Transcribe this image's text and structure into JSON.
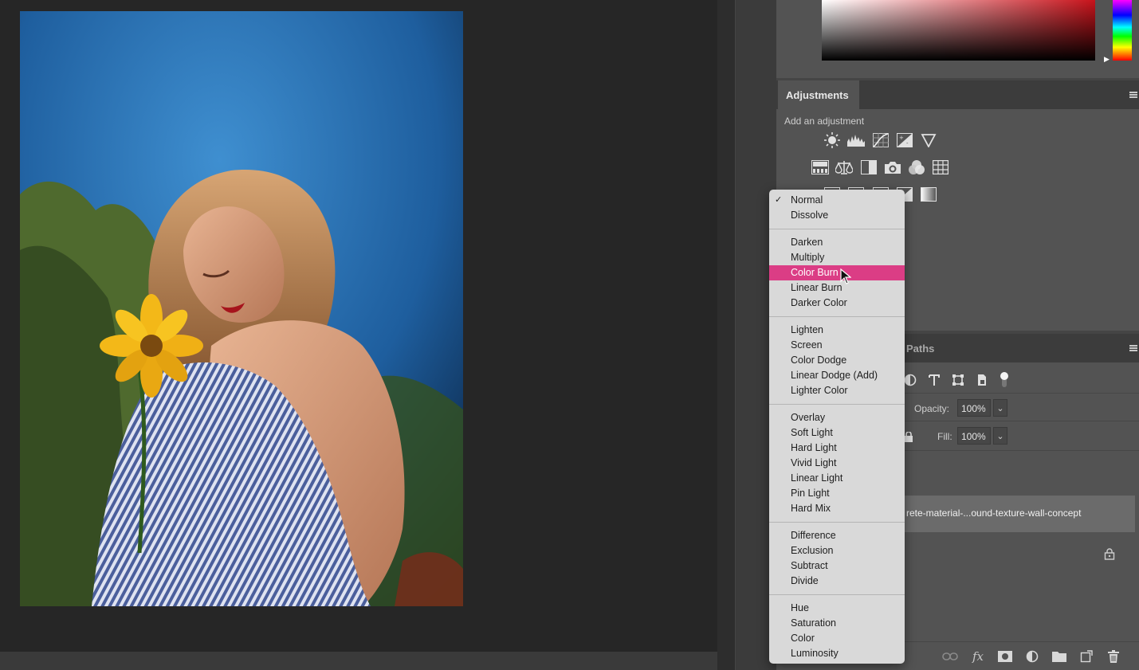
{
  "adjustments_panel": {
    "tab_label": "Adjustments",
    "add_label": "Add an adjustment",
    "icons_row1": [
      "brightness-contrast-icon",
      "levels-icon",
      "curves-icon",
      "exposure-icon",
      "vibrance-icon"
    ],
    "icons_row2": [
      "hue-saturation-icon",
      "color-balance-icon",
      "black-white-icon",
      "photo-filter-icon",
      "channel-mixer-icon",
      "color-lookup-icon"
    ],
    "icons_row3": [
      "invert-icon",
      "posterize-icon",
      "threshold-icon",
      "gradient-map-icon",
      "selective-color-icon"
    ]
  },
  "layers_panel": {
    "paths_tab_label": "Paths",
    "filter_icons": [
      "adjustment-filter-icon",
      "type-filter-icon",
      "shape-filter-icon",
      "smart-object-filter-icon",
      "filter-toggle-icon"
    ],
    "opacity_label": "Opacity:",
    "opacity_value": "100%",
    "fill_label": "Fill:",
    "fill_value": "100%",
    "layer_name": "rete-material-...ound-texture-wall-concept",
    "footer_icons": [
      "link-layers-icon",
      "layer-style-icon",
      "layer-mask-icon",
      "adjustment-layer-icon",
      "group-folder-icon",
      "new-layer-icon",
      "delete-layer-icon"
    ],
    "footer_glyphs": {
      "fx": "fx"
    }
  },
  "blend_menu": {
    "checked_item": "Normal",
    "highlighted_item": "Color Burn",
    "highlight_color": "#db3d85",
    "groups": [
      [
        "Normal",
        "Dissolve"
      ],
      [
        "Darken",
        "Multiply",
        "Color Burn",
        "Linear Burn",
        "Darker Color"
      ],
      [
        "Lighten",
        "Screen",
        "Color Dodge",
        "Linear Dodge (Add)",
        "Lighter Color"
      ],
      [
        "Overlay",
        "Soft Light",
        "Hard Light",
        "Vivid Light",
        "Linear Light",
        "Pin Light",
        "Hard Mix"
      ],
      [
        "Difference",
        "Exclusion",
        "Subtract",
        "Divide"
      ],
      [
        "Hue",
        "Saturation",
        "Color",
        "Luminosity"
      ]
    ]
  },
  "glyphs": {
    "check": "✓",
    "chevron": "⌄",
    "hue_marker": "▶"
  },
  "colors": {
    "app_background": "#262626",
    "panel_background": "#535353",
    "menu_background": "#d9d9d9",
    "foreground_red": "#c8131b"
  }
}
